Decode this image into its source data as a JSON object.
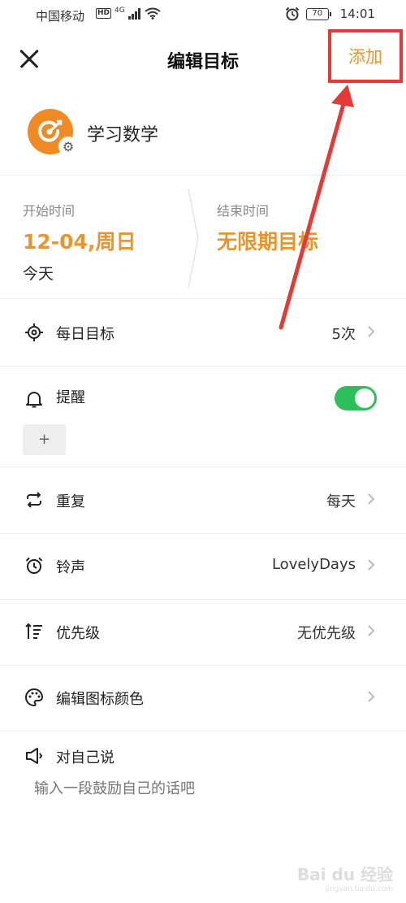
{
  "status_bar": {
    "carrier": "中国移动",
    "hd": "HD",
    "network": "4G",
    "battery": "70",
    "time": "14:01"
  },
  "header": {
    "title": "编辑目标",
    "add_label": "添加",
    "highlight_color": "#e53935"
  },
  "goal": {
    "name": "学习数学",
    "icon_color": "#f08a24"
  },
  "dates": {
    "start_label": "开始时间",
    "start_value": "12-04,周日",
    "start_sub": "今天",
    "end_label": "结束时间",
    "end_value": "无限期目标",
    "accent_color": "#e8952e"
  },
  "rows": {
    "daily_goal": {
      "label": "每日目标",
      "value": "5次"
    },
    "reminder": {
      "label": "提醒",
      "enabled": true,
      "add_label": "+"
    },
    "repeat": {
      "label": "重复",
      "value": "每天"
    },
    "ringtone": {
      "label": "铃声",
      "value": "LovelyDays"
    },
    "priority": {
      "label": "优先级",
      "value": "无优先级"
    },
    "icon_color": {
      "label": "编辑图标颜色"
    }
  },
  "note": {
    "label": "对自己说",
    "placeholder": "输入一段鼓励自己的话吧"
  },
  "watermark": {
    "brand": "Bai du 经验",
    "url": "jingyan.baidu.com"
  },
  "toggle_color": "#2dbf5a"
}
